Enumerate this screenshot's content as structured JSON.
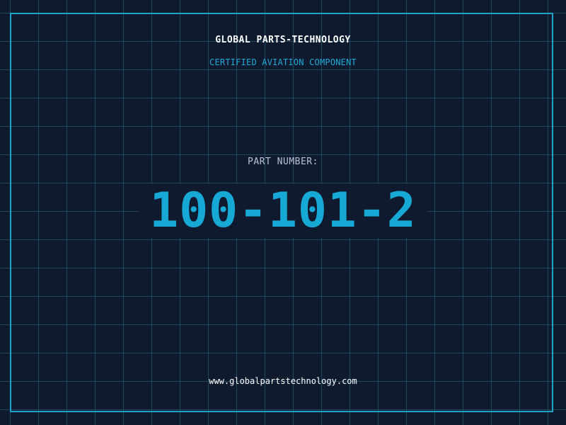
{
  "header": {
    "company": "GLOBAL PARTS-TECHNOLOGY",
    "subtitle": "CERTIFIED AVIATION COMPONENT"
  },
  "part": {
    "label": "PART NUMBER:",
    "number": "100-101-2"
  },
  "footer": {
    "website": "www.globalpartstechnology.com"
  },
  "colors": {
    "background": "#101a2e",
    "grid": "#1d4a5f",
    "frame": "#1ea3c9",
    "accent": "#17a9d6",
    "label": "#b8c2d0",
    "text": "#ffffff"
  }
}
